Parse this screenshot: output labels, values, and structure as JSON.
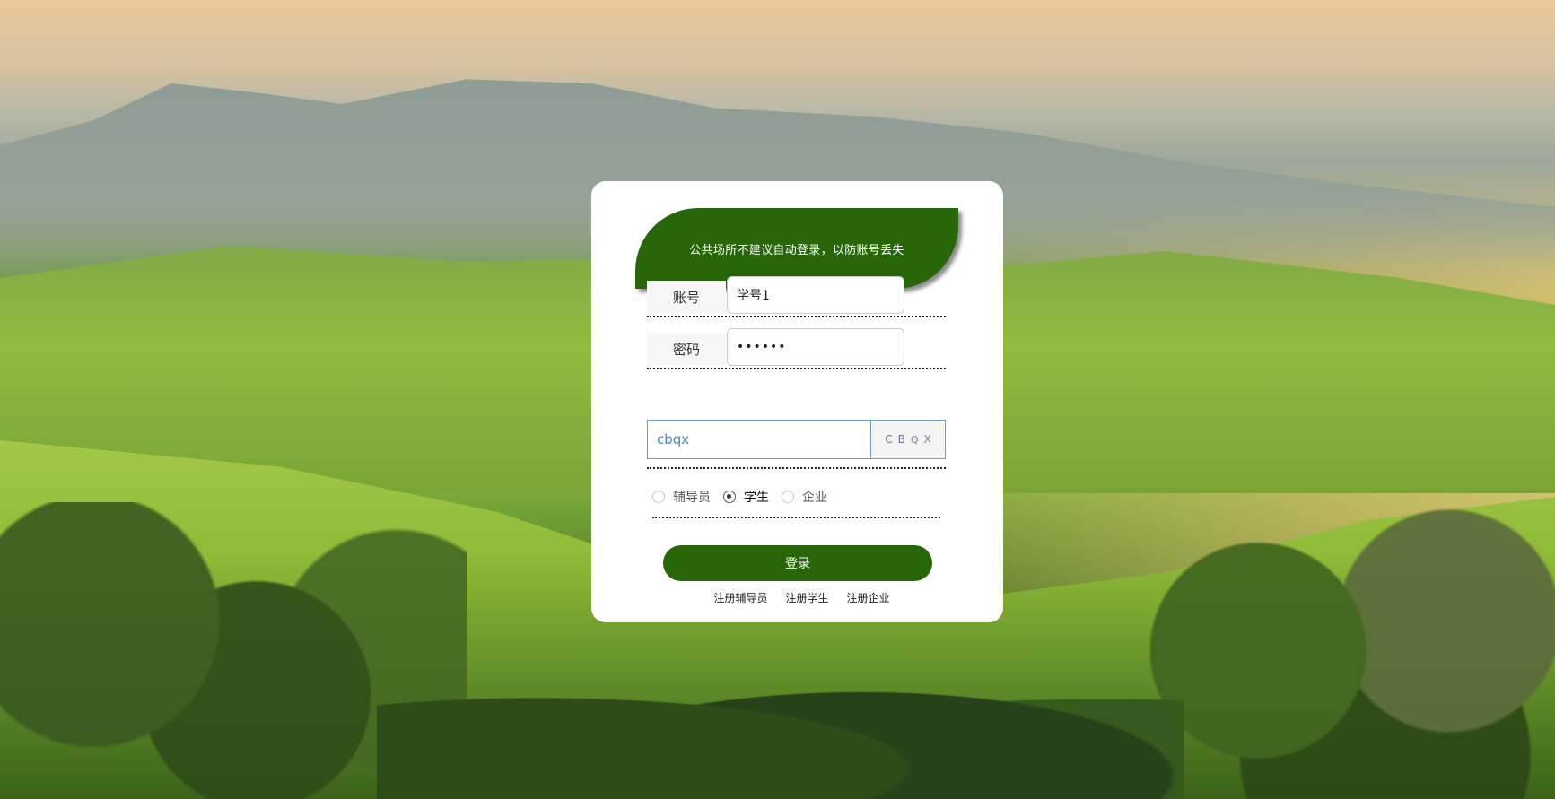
{
  "notice": "公共场所不建议自动登录，以防账号丢失",
  "account": {
    "label": "账号",
    "value": "学号1"
  },
  "password": {
    "label": "密码",
    "value": "••••••"
  },
  "captcha": {
    "value": "cbqx",
    "image_chars": [
      "C",
      "B",
      "Q",
      "X"
    ]
  },
  "roles": [
    {
      "label": "辅导员",
      "selected": false
    },
    {
      "label": "学生",
      "selected": true
    },
    {
      "label": "企业",
      "selected": false
    }
  ],
  "login_label": "登录",
  "register_links": [
    "注册辅导员",
    "注册学生",
    "注册企业"
  ],
  "colors": {
    "primary_green": "#276709",
    "card_bg": "#ffffff"
  }
}
